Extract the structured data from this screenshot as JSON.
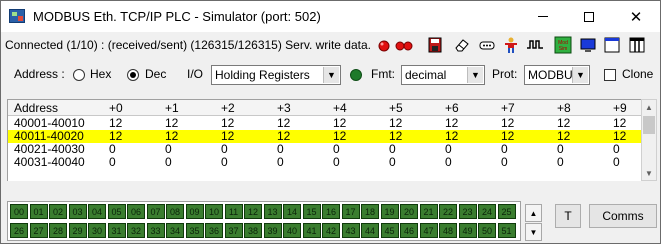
{
  "window": {
    "title": "MODBUS Eth. TCP/IP PLC - Simulator (port: 502)",
    "controls": {
      "minimize": "minimize-icon",
      "maximize": "maximize-icon",
      "close": "close-icon"
    }
  },
  "status": {
    "text": "Connected (1/10) : (received/sent) (126315/126315) Serv. write data."
  },
  "toolbar": {
    "icons": [
      "red-led-icon",
      "red-led-pair-icon",
      "save-disk-icon",
      "eraser-icon",
      "connector-icon",
      "person-icon",
      "waveform-icon",
      "mod-sim-icon",
      "blue-screen-icon",
      "window-icon",
      "columns-icon"
    ]
  },
  "controls": {
    "address_label": "Address :",
    "hex_label": "Hex",
    "dec_label": "Dec",
    "io_label": "I/O",
    "io_value": "Holding Registers",
    "fmt_label": "Fmt:",
    "fmt_value": "decimal",
    "prot_label": "Prot:",
    "prot_value": "MODBUS",
    "clone_label": "Clone",
    "address_mode": "Dec",
    "led_color": "#1e7a2a"
  },
  "grid": {
    "address_header": "Address",
    "columns": [
      "+0",
      "+1",
      "+2",
      "+3",
      "+4",
      "+5",
      "+6",
      "+7",
      "+8",
      "+9"
    ],
    "rows": [
      {
        "address": "40001-40010",
        "values": [
          "12",
          "12",
          "12",
          "12",
          "12",
          "12",
          "12",
          "12",
          "12",
          "12"
        ]
      },
      {
        "address": "40011-40020",
        "values": [
          "12",
          "12",
          "12",
          "12",
          "12",
          "12",
          "12",
          "12",
          "12",
          "12"
        ]
      },
      {
        "address": "40021-40030",
        "values": [
          "0",
          "0",
          "0",
          "0",
          "0",
          "0",
          "0",
          "0",
          "0",
          "0"
        ]
      },
      {
        "address": "40031-40040",
        "values": [
          "0",
          "0",
          "0",
          "0",
          "0",
          "0",
          "0",
          "0",
          "0",
          "0"
        ]
      }
    ],
    "highlight_color": "#ffff00"
  },
  "coils": {
    "row1": [
      "00",
      "01",
      "02",
      "03",
      "04",
      "05",
      "06",
      "07",
      "08",
      "09",
      "10",
      "11",
      "12",
      "13",
      "14",
      "15",
      "16",
      "17",
      "18",
      "19",
      "20",
      "21",
      "22",
      "23",
      "24",
      "25"
    ],
    "row2": [
      "26",
      "27",
      "28",
      "29",
      "30",
      "31",
      "32",
      "33",
      "34",
      "35",
      "36",
      "37",
      "38",
      "39",
      "40",
      "41",
      "42",
      "43",
      "44",
      "45",
      "46",
      "47",
      "48",
      "49",
      "50",
      "51"
    ],
    "color": "#3a7d2f"
  },
  "buttons": {
    "t_label": "T",
    "comms_label": "Comms"
  }
}
